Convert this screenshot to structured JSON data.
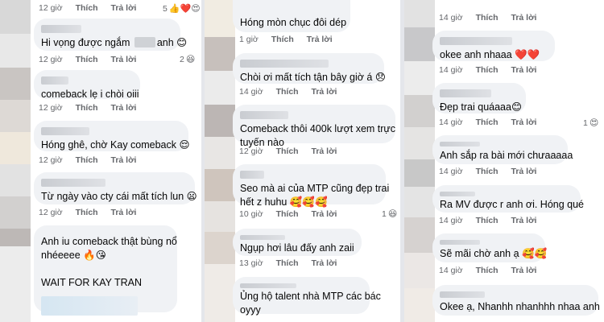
{
  "actions": {
    "like": "Thích",
    "reply": "Trả lời"
  },
  "columns": [
    {
      "comments": [
        {
          "time": "12 giờ",
          "reaction_count": "5",
          "reaction_icons": "👍❤️😍"
        },
        {
          "text_before": "Hi vọng được ngắm ",
          "text_after": "anh 😊",
          "time": "12 giờ",
          "reaction_count": "2",
          "reaction_icons": "😆"
        },
        {
          "text": "comeback lẹ i chòi oiii",
          "time": "12 giờ"
        },
        {
          "text": "Hóng ghê, chờ Kay comeback 😌",
          "time": "12 giờ"
        },
        {
          "text": "Từ ngày vào cty cái mất tích lun 😦",
          "time": "12 giờ"
        },
        {
          "lines": [
            "Anh iu comeback thật bùng nổ",
            "nhéeeee 🔥😘",
            "",
            "WAIT FOR KAY TRAN"
          ]
        }
      ]
    },
    {
      "comments": [
        {
          "text": "Hóng mòn chục đôi dép",
          "time": "1 giờ"
        },
        {
          "text": "Chòi ơi mất tích tận bây giờ á 😞",
          "time": "14 giờ"
        },
        {
          "lines": [
            "Comeback thôi 400k lượt xem trực",
            "tuyến nào"
          ],
          "time": "12 giờ"
        },
        {
          "lines": [
            "Seo mà ai của MTP cũng đẹp trai",
            "hết z huhu 🥰🥰🥰"
          ],
          "time": "10 giờ",
          "reaction_count": "1",
          "reaction_icons": "😆"
        },
        {
          "text": "Ngụp hơi lâu đấy anh zaii",
          "time": "13 giờ"
        },
        {
          "lines": [
            "Ủng hộ talent nhà MTP các bác",
            "oyyy"
          ]
        }
      ]
    },
    {
      "comments": [
        {
          "time": "14 giờ"
        },
        {
          "text": "okee anh nhaaa ❤️❤️",
          "time": "14 giờ"
        },
        {
          "text": "Đẹp trai quáaaa😊",
          "time": "14 giờ",
          "reaction_count": "1",
          "reaction_icons": "😍"
        },
        {
          "text": "Anh sắp ra bài mới chưaaaaa",
          "time": "14 giờ"
        },
        {
          "text": "Ra MV được r anh ơi. Hóng qué",
          "time": "14 giờ"
        },
        {
          "text": "Sẽ mãi chờ anh ạ 🥰🥰",
          "time": "14 giờ"
        },
        {
          "text": "Okee ạ, Nhanhh nhanhhh nhaa anh"
        }
      ]
    }
  ]
}
